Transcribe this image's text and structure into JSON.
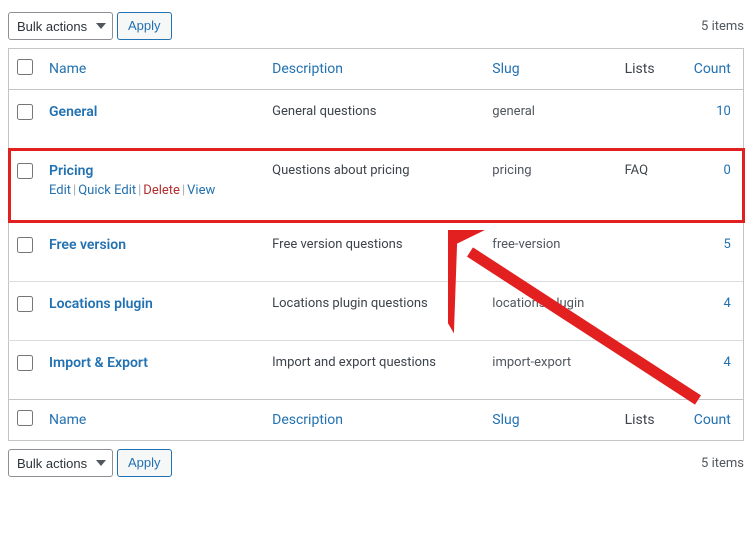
{
  "tablenav": {
    "bulk_label": "Bulk actions",
    "apply_label": "Apply",
    "items_count_text": "5 items"
  },
  "columns": {
    "name": "Name",
    "description": "Description",
    "slug": "Slug",
    "lists": "Lists",
    "count": "Count"
  },
  "row_actions": {
    "edit": "Edit",
    "quick_edit": "Quick Edit",
    "delete": "Delete",
    "view": "View"
  },
  "rows": [
    {
      "name": "General",
      "description": "General questions",
      "slug": "general",
      "lists": "",
      "count": "10",
      "highlight": false,
      "show_actions": false
    },
    {
      "name": "Pricing",
      "description": "Questions about pricing",
      "slug": "pricing",
      "lists": "FAQ",
      "count": "0",
      "highlight": true,
      "show_actions": true
    },
    {
      "name": "Free version",
      "description": "Free version questions",
      "slug": "free-version",
      "lists": "",
      "count": "5",
      "highlight": false,
      "show_actions": false
    },
    {
      "name": "Locations plugin",
      "description": "Locations plugin questions",
      "slug": "locations-plugin",
      "lists": "",
      "count": "4",
      "highlight": false,
      "show_actions": false
    },
    {
      "name": "Import & Export",
      "description": "Import and export questions",
      "slug": "import-export",
      "lists": "",
      "count": "4",
      "highlight": false,
      "show_actions": false
    }
  ]
}
